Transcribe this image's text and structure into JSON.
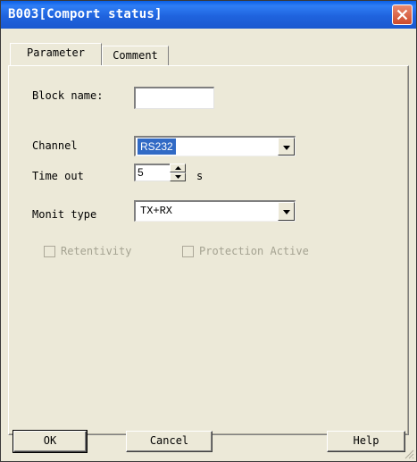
{
  "window": {
    "title": "B003[Comport status]"
  },
  "tabs": [
    {
      "label": "Parameter",
      "active": true
    },
    {
      "label": "Comment",
      "active": false
    }
  ],
  "form": {
    "block_name": {
      "label": "Block name:",
      "value": ""
    },
    "channel": {
      "label": "Channel",
      "value": "RS232"
    },
    "time_out": {
      "label": "Time out",
      "value": "5",
      "unit": "s"
    },
    "monit_type": {
      "label": "Monit type",
      "value": "TX+RX"
    },
    "retentivity": {
      "label": "Retentivity",
      "checked": false,
      "enabled": false
    },
    "protection_active": {
      "label": "Protection Active",
      "checked": false,
      "enabled": false
    }
  },
  "buttons": {
    "ok": "OK",
    "cancel": "Cancel",
    "help": "Help"
  },
  "colors": {
    "titlebar": "#1f63de",
    "selection": "#316ac5",
    "close": "#cd4a2b",
    "dialog_bg": "#ece9d8"
  },
  "icons": [
    "close-icon",
    "dropdown-arrow-icon",
    "spin-up-icon",
    "spin-down-icon",
    "resize-grip-icon"
  ]
}
